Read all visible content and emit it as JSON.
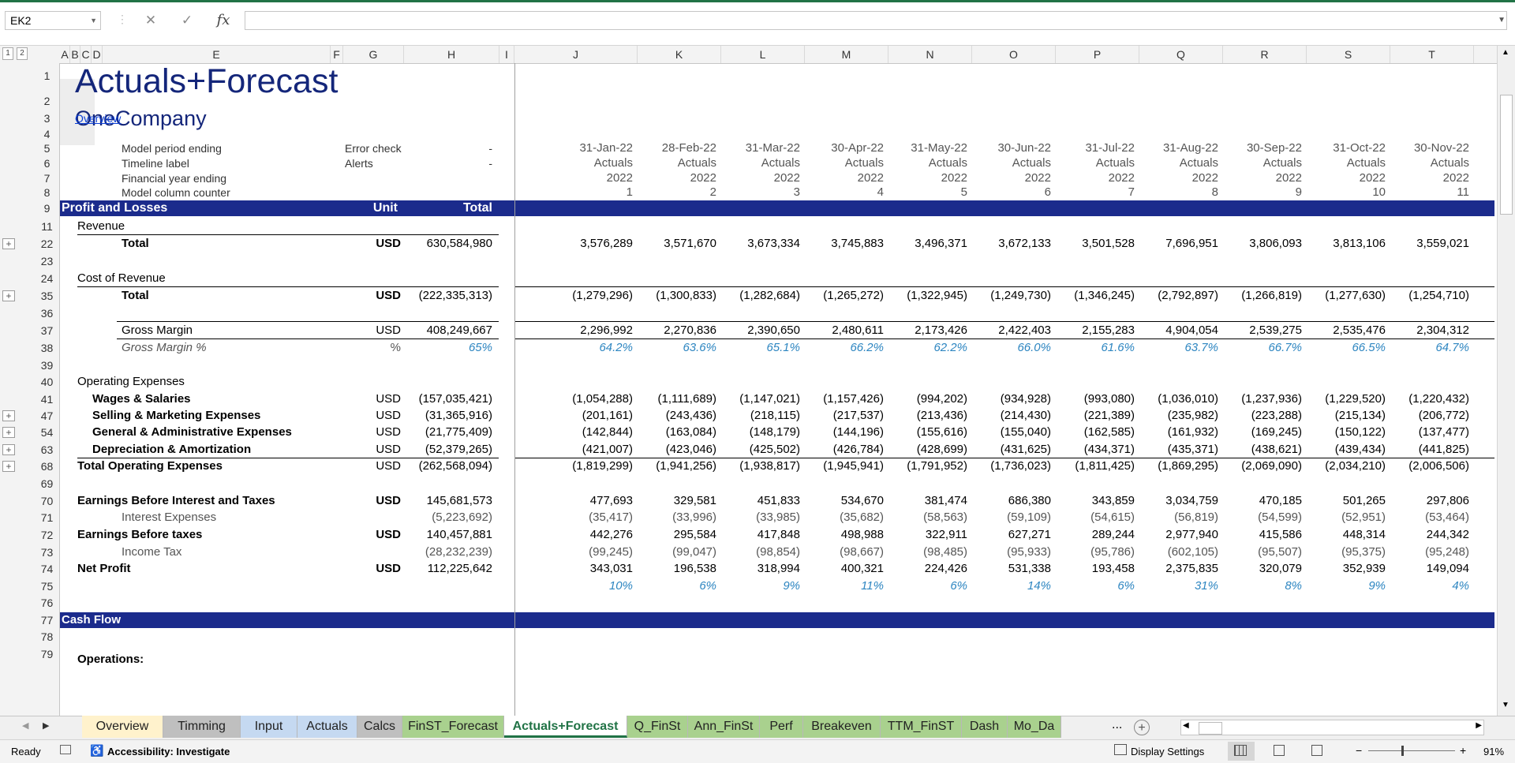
{
  "name_box": "EK2",
  "formula_icons": {
    "cancel": "✕",
    "enter": "✓",
    "fx": "fx"
  },
  "level_buttons": [
    "1",
    "2"
  ],
  "col_headers": [
    "A",
    "B",
    "C",
    "D",
    "E",
    "F",
    "G",
    "H",
    "I",
    "J",
    "K",
    "L",
    "M",
    "N",
    "O",
    "P",
    "Q",
    "R",
    "S",
    "T"
  ],
  "title": "Actuals+Forecast",
  "company": "OneCompany",
  "link_overview": "Overview",
  "meta": {
    "period_label": "Model period ending",
    "timeline_label": "Timeline label",
    "fy_label": "Financial year ending",
    "counter_label": "Model column counter",
    "error_check_label": "Error check",
    "error_check_value": "-",
    "alerts_label": "Alerts",
    "alerts_value": "-",
    "dates": [
      "31-Jan-22",
      "28-Feb-22",
      "31-Mar-22",
      "30-Apr-22",
      "31-May-22",
      "30-Jun-22",
      "31-Jul-22",
      "31-Aug-22",
      "30-Sep-22",
      "31-Oct-22",
      "30-Nov-22"
    ],
    "timeline": [
      "Actuals",
      "Actuals",
      "Actuals",
      "Actuals",
      "Actuals",
      "Actuals",
      "Actuals",
      "Actuals",
      "Actuals",
      "Actuals",
      "Actuals"
    ],
    "fy": [
      "2022",
      "2022",
      "2022",
      "2022",
      "2022",
      "2022",
      "2022",
      "2022",
      "2022",
      "2022",
      "2022"
    ],
    "counter": [
      "1",
      "2",
      "3",
      "4",
      "5",
      "6",
      "7",
      "8",
      "9",
      "10",
      "11"
    ]
  },
  "pl_header": {
    "label": "Profit and Losses",
    "unit": "Unit",
    "total": "Total"
  },
  "revenue": {
    "section": "Revenue",
    "label": "Total",
    "unit": "USD",
    "total": "630,584,980",
    "values": [
      "3,576,289",
      "3,571,670",
      "3,673,334",
      "3,745,883",
      "3,496,371",
      "3,672,133",
      "3,501,528",
      "7,696,951",
      "3,806,093",
      "3,813,106",
      "3,559,021"
    ]
  },
  "cost": {
    "section": "Cost of Revenue",
    "label": "Total",
    "unit": "USD",
    "total": "(222,335,313)",
    "values": [
      "(1,279,296)",
      "(1,300,833)",
      "(1,282,684)",
      "(1,265,272)",
      "(1,322,945)",
      "(1,249,730)",
      "(1,346,245)",
      "(2,792,897)",
      "(1,266,819)",
      "(1,277,630)",
      "(1,254,710)"
    ]
  },
  "gross_margin": {
    "label": "Gross Margin",
    "unit": "USD",
    "total": "408,249,667",
    "values": [
      "2,296,992",
      "2,270,836",
      "2,390,650",
      "2,480,611",
      "2,173,426",
      "2,422,403",
      "2,155,283",
      "4,904,054",
      "2,539,275",
      "2,535,476",
      "2,304,312"
    ]
  },
  "gross_margin_pct": {
    "label": "Gross Margin %",
    "unit": "%",
    "total": "65%",
    "values": [
      "64.2%",
      "63.6%",
      "65.1%",
      "66.2%",
      "62.2%",
      "66.0%",
      "61.6%",
      "63.7%",
      "66.7%",
      "66.5%",
      "64.7%"
    ]
  },
  "opex_section": "Operating Expenses",
  "wages": {
    "label": "Wages & Salaries",
    "unit": "USD",
    "total": "(157,035,421)",
    "values": [
      "(1,054,288)",
      "(1,111,689)",
      "(1,147,021)",
      "(1,157,426)",
      "(994,202)",
      "(934,928)",
      "(993,080)",
      "(1,036,010)",
      "(1,237,936)",
      "(1,229,520)",
      "(1,220,432)"
    ]
  },
  "selling": {
    "label": "Selling & Marketing Expenses",
    "unit": "USD",
    "total": "(31,365,916)",
    "values": [
      "(201,161)",
      "(243,436)",
      "(218,115)",
      "(217,537)",
      "(213,436)",
      "(214,430)",
      "(221,389)",
      "(235,982)",
      "(223,288)",
      "(215,134)",
      "(206,772)"
    ]
  },
  "ga": {
    "label": "General & Administrative Expenses",
    "unit": "USD",
    "total": "(21,775,409)",
    "values": [
      "(142,844)",
      "(163,084)",
      "(148,179)",
      "(144,196)",
      "(155,616)",
      "(155,040)",
      "(162,585)",
      "(161,932)",
      "(169,245)",
      "(150,122)",
      "(137,477)"
    ]
  },
  "da": {
    "label": "Depreciation & Amortization",
    "unit": "USD",
    "total": "(52,379,265)",
    "values": [
      "(421,007)",
      "(423,046)",
      "(425,502)",
      "(426,784)",
      "(428,699)",
      "(431,625)",
      "(434,371)",
      "(435,371)",
      "(438,621)",
      "(439,434)",
      "(441,825)"
    ]
  },
  "total_opex": {
    "label": "Total Operating Expenses",
    "unit": "USD",
    "total": "(262,568,094)",
    "values": [
      "(1,819,299)",
      "(1,941,256)",
      "(1,938,817)",
      "(1,945,941)",
      "(1,791,952)",
      "(1,736,023)",
      "(1,811,425)",
      "(1,869,295)",
      "(2,069,090)",
      "(2,034,210)",
      "(2,006,506)"
    ]
  },
  "ebit": {
    "label": "Earnings Before Interest and Taxes",
    "unit": "USD",
    "total": "145,681,573",
    "values": [
      "477,693",
      "329,581",
      "451,833",
      "534,670",
      "381,474",
      "686,380",
      "343,859",
      "3,034,759",
      "470,185",
      "501,265",
      "297,806"
    ]
  },
  "interest": {
    "label": "Interest Expenses",
    "total": "(5,223,692)",
    "values": [
      "(35,417)",
      "(33,996)",
      "(33,985)",
      "(35,682)",
      "(58,563)",
      "(59,109)",
      "(54,615)",
      "(56,819)",
      "(54,599)",
      "(52,951)",
      "(53,464)"
    ]
  },
  "ebt": {
    "label": "Earnings Before taxes",
    "unit": "USD",
    "total": "140,457,881",
    "values": [
      "442,276",
      "295,584",
      "417,848",
      "498,988",
      "322,911",
      "627,271",
      "289,244",
      "2,977,940",
      "415,586",
      "448,314",
      "244,342"
    ]
  },
  "tax": {
    "label": "Income Tax",
    "total": "(28,232,239)",
    "values": [
      "(99,245)",
      "(99,047)",
      "(98,854)",
      "(98,667)",
      "(98,485)",
      "(95,933)",
      "(95,786)",
      "(602,105)",
      "(95,507)",
      "(95,375)",
      "(95,248)"
    ]
  },
  "net": {
    "label": "Net Profit",
    "unit": "USD",
    "total": "112,225,642",
    "values": [
      "343,031",
      "196,538",
      "318,994",
      "400,321",
      "224,426",
      "531,338",
      "193,458",
      "2,375,835",
      "320,079",
      "352,939",
      "149,094"
    ]
  },
  "net_pct": {
    "values": [
      "10%",
      "6%",
      "9%",
      "11%",
      "6%",
      "14%",
      "6%",
      "31%",
      "8%",
      "9%",
      "4%"
    ]
  },
  "cash_flow": "Cash Flow",
  "operations": "Operations:",
  "row_numbers": [
    "1",
    "2",
    "3",
    "4",
    "5",
    "6",
    "7",
    "8",
    "9",
    "11",
    "22",
    "23",
    "24",
    "35",
    "36",
    "37",
    "38",
    "39",
    "40",
    "41",
    "47",
    "54",
    "63",
    "68",
    "69",
    "70",
    "71",
    "72",
    "73",
    "74",
    "75",
    "76",
    "77",
    "78",
    "79"
  ],
  "tabs": [
    {
      "label": "Overview",
      "color": "#fff2cc"
    },
    {
      "label": "Timming",
      "color": "#bfbfbf"
    },
    {
      "label": "Input",
      "color": "#c5d9f1"
    },
    {
      "label": "Actuals",
      "color": "#c5d9f1"
    },
    {
      "label": "Calcs",
      "color": "#bfbfbf"
    },
    {
      "label": "FinST_Forecast",
      "color": "#a9d18e"
    },
    {
      "label": "Actuals+Forecast",
      "color": "#ffffff"
    },
    {
      "label": "Q_FinSt",
      "color": "#a9d18e"
    },
    {
      "label": "Ann_FinSt",
      "color": "#a9d18e"
    },
    {
      "label": "Perf",
      "color": "#a9d18e"
    },
    {
      "label": "Breakeven",
      "color": "#a9d18e"
    },
    {
      "label": "TTM_FinST",
      "color": "#a9d18e"
    },
    {
      "label": "Dash",
      "color": "#a9d18e"
    },
    {
      "label": "Mo_Da",
      "color": "#a9d18e"
    }
  ],
  "tabs_more": "...",
  "status": {
    "ready": "Ready",
    "accessibility": "Accessibility: Investigate",
    "display_settings": "Display Settings",
    "zoom": "91%"
  },
  "colors": {
    "band": "#1b2b8c",
    "timeline_fill": "#cfe2db",
    "alert_fill": "#ffe699",
    "excel_green": "#217346",
    "pct_blue": "#2e86c1"
  }
}
